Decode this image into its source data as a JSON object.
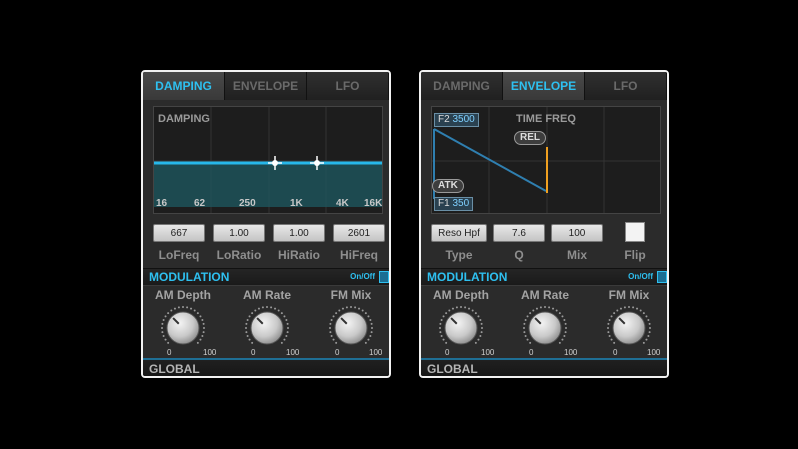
{
  "left_panel": {
    "tabs": [
      "DAMPING",
      "ENVELOPE",
      "LFO"
    ],
    "active_tab": 0,
    "display_title": "DAMPING",
    "freq_labels": [
      "16",
      "62",
      "250",
      "1K",
      "4K",
      "16K"
    ],
    "values": [
      "667",
      "1.00",
      "1.00",
      "2601"
    ],
    "value_labels": [
      "LoFreq",
      "LoRatio",
      "HiRatio",
      "HiFreq"
    ],
    "modulation": {
      "title": "MODULATION",
      "onoff": "On/Off",
      "knobs": [
        {
          "label": "AM Depth",
          "min": "0",
          "max": "100"
        },
        {
          "label": "AM Rate",
          "min": "0",
          "max": "100"
        },
        {
          "label": "FM Mix",
          "min": "0",
          "max": "100"
        }
      ]
    },
    "global_label": "GLOBAL"
  },
  "right_panel": {
    "tabs": [
      "DAMPING",
      "ENVELOPE",
      "LFO"
    ],
    "active_tab": 1,
    "display_title": "TIME FREQ",
    "f2_label": "F2",
    "f2_value": "3500",
    "f1_label": "F1",
    "f1_value": "350",
    "rel_label": "REL",
    "atk_label": "ATK",
    "values": [
      "Reso Hpf",
      "7.6",
      "100"
    ],
    "value_labels": [
      "Type",
      "Q",
      "Mix",
      "Flip"
    ],
    "modulation": {
      "title": "MODULATION",
      "onoff": "On/Off",
      "knobs": [
        {
          "label": "AM Depth",
          "min": "0",
          "max": "100"
        },
        {
          "label": "AM Rate",
          "min": "0",
          "max": "100"
        },
        {
          "label": "FM Mix",
          "min": "0",
          "max": "100"
        }
      ]
    },
    "global_label": "GLOBAL"
  },
  "colors": {
    "accent": "#2ec0f0",
    "envelope_release": "#f0a020",
    "background": "#000000",
    "panel": "#2b2b2b"
  }
}
